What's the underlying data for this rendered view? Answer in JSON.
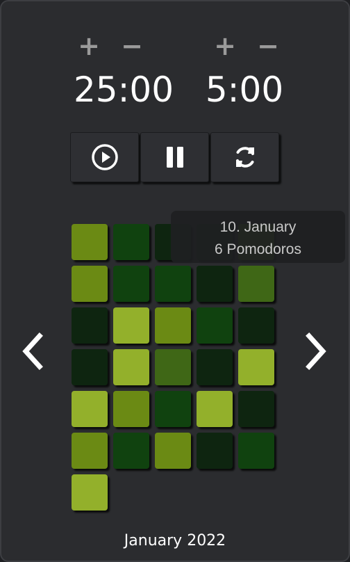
{
  "work_timer": {
    "increment_label": "+",
    "decrement_label": "−",
    "value": "25:00"
  },
  "break_timer": {
    "increment_label": "+",
    "decrement_label": "−",
    "value": "5:00"
  },
  "controls": {
    "play_icon": "play-icon",
    "pause_icon": "pause-icon",
    "reset_icon": "refresh-icon"
  },
  "navigation": {
    "prev_icon": "chevron-left-icon",
    "next_icon": "chevron-right-icon"
  },
  "calendar": {
    "month_label": "January 2022",
    "level_colors": [
      "#0e2510",
      "#10420f",
      "#3f6716",
      "#6b8a14",
      "#93b02b"
    ],
    "days": [
      3,
      1,
      0,
      0,
      2,
      3,
      1,
      1,
      0,
      2,
      0,
      4,
      3,
      1,
      0,
      0,
      4,
      2,
      0,
      4,
      4,
      3,
      1,
      4,
      0,
      3,
      1,
      3,
      0,
      1,
      4
    ]
  },
  "tooltip": {
    "date": "10. January",
    "count": "6 Pomodoros"
  },
  "colors": {
    "background": "#2b2c2f",
    "button": "#2e2f33",
    "adjust_text": "#9a9a9a",
    "text": "#ffffff"
  }
}
